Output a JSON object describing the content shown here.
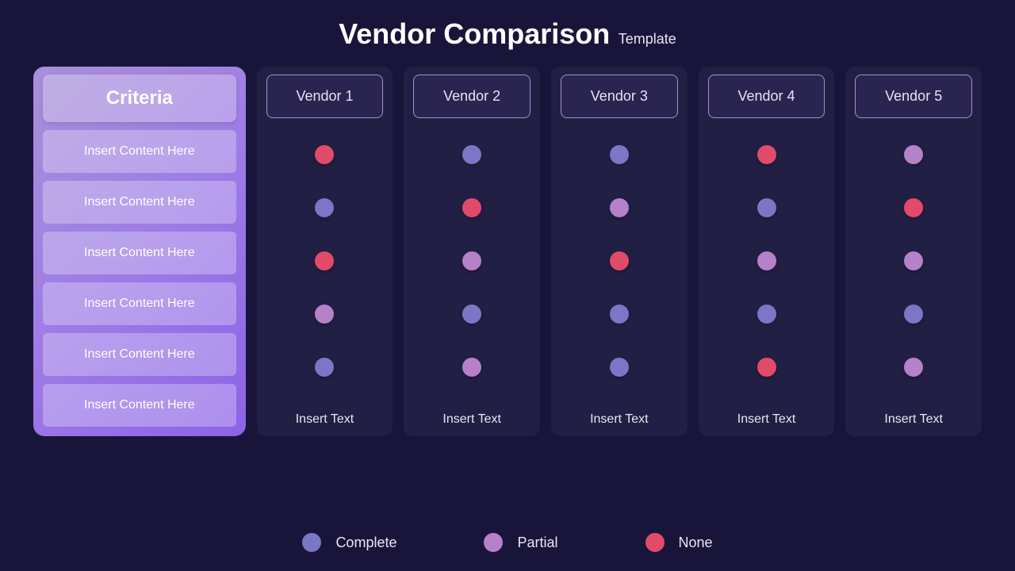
{
  "title": {
    "main": "Vendor Comparison",
    "sub": "Template"
  },
  "criteria": {
    "header": "Criteria",
    "rows": [
      "Insert Content Here",
      "Insert Content Here",
      "Insert Content Here",
      "Insert Content Here",
      "Insert Content Here",
      "Insert Content Here"
    ],
    "rowCount": 6
  },
  "vendors": [
    {
      "name": "Vendor 1",
      "dots": [
        "none",
        "complete",
        "none",
        "partial",
        "complete"
      ],
      "footer": "Insert Text"
    },
    {
      "name": "Vendor 2",
      "dots": [
        "complete",
        "none",
        "partial",
        "complete",
        "partial"
      ],
      "footer": "Insert Text"
    },
    {
      "name": "Vendor 3",
      "dots": [
        "complete",
        "partial",
        "none",
        "complete",
        "complete"
      ],
      "footer": "Insert Text"
    },
    {
      "name": "Vendor 4",
      "dots": [
        "none",
        "complete",
        "partial",
        "complete",
        "none"
      ],
      "footer": "Insert Text"
    },
    {
      "name": "Vendor 5",
      "dots": [
        "partial",
        "none",
        "partial",
        "complete",
        "partial"
      ],
      "footer": "Insert Text"
    }
  ],
  "legend": [
    {
      "key": "complete",
      "label": "Complete",
      "color": "#7b76c6"
    },
    {
      "key": "partial",
      "label": "Partial",
      "color": "#b581c9"
    },
    {
      "key": "none",
      "label": "None",
      "color": "#e24a6a"
    }
  ]
}
